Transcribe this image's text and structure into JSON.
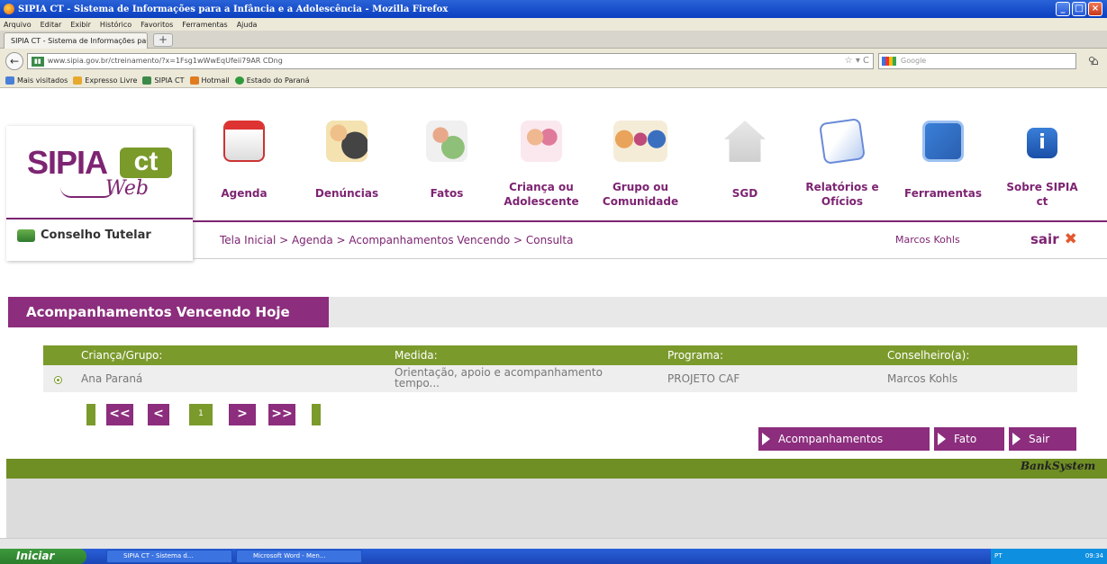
{
  "browser": {
    "window_title": "SIPIA CT - Sistema de Informações para a Infância e a Adolescência - Mozilla Firefox",
    "menu": [
      "Arquivo",
      "Editar",
      "Exibir",
      "Histórico",
      "Favoritos",
      "Ferramentas",
      "Ajuda"
    ],
    "tab_title": "SIPIA CT - Sistema de Informações para a I...",
    "url": "www.sipia.gov.br/ctreinamento/?x=1Fsg1wWwEqUfeii79AR CDng",
    "search_placeholder": "Google",
    "bookmarks": [
      "Mais visitados",
      "Expresso Livre",
      "SIPIA CT",
      "Hotmail",
      "Estado do Paraná"
    ]
  },
  "logo": {
    "sipia": "SIPIA",
    "ct": "ct",
    "web": "Web",
    "subtitle": "Conselho Tutelar"
  },
  "nav": [
    {
      "label": "Agenda",
      "icon": "calendar-icon"
    },
    {
      "label": "Denúncias",
      "icon": "people-report-icon"
    },
    {
      "label": "Fatos",
      "icon": "user-check-icon"
    },
    {
      "label": "Criança ou Adolescente",
      "icon": "children-icon"
    },
    {
      "label": "Grupo ou Comunidade",
      "icon": "group-icon"
    },
    {
      "label": "SGD",
      "icon": "house-icon"
    },
    {
      "label": "Relatórios e Ofícios",
      "icon": "documents-icon"
    },
    {
      "label": "Ferramentas",
      "icon": "tools-icon"
    },
    {
      "label": "Sobre SIPIA ct",
      "icon": "info-icon"
    }
  ],
  "breadcrumb": "Tela Inicial > Agenda > Acompanhamentos Vencendo > Consulta",
  "user_name": "Marcos Kohls",
  "logout": "sair",
  "section_title": "Acompanhamentos Vencendo Hoje",
  "table": {
    "headers": [
      "Criança/Grupo:",
      "Medida:",
      "Programa:",
      "Conselheiro(a):"
    ],
    "rows": [
      {
        "crianca": "Ana Paraná",
        "medida_1": "Orientação, apoio e acompanhamento",
        "medida_2": "tempo...",
        "programa": "PROJETO CAF",
        "conselheiro": "Marcos Kohls"
      }
    ]
  },
  "pager": {
    "first": "<<",
    "prev": "<",
    "page": "1",
    "next": ">",
    "last": ">>"
  },
  "actions": {
    "acompanhamentos": "Acompanhamentos",
    "fato": "Fato",
    "sair": "Sair"
  },
  "footer_brand": "BankSystem",
  "taskbar": {
    "start": "Iniciar",
    "task1": "SIPIA CT - Sistema d...",
    "task2": "Microsoft Word - Men...",
    "lang": "PT",
    "time": "09:34"
  },
  "colors": {
    "primary": "#8c2d7d",
    "secondary": "#7b9a2c"
  }
}
